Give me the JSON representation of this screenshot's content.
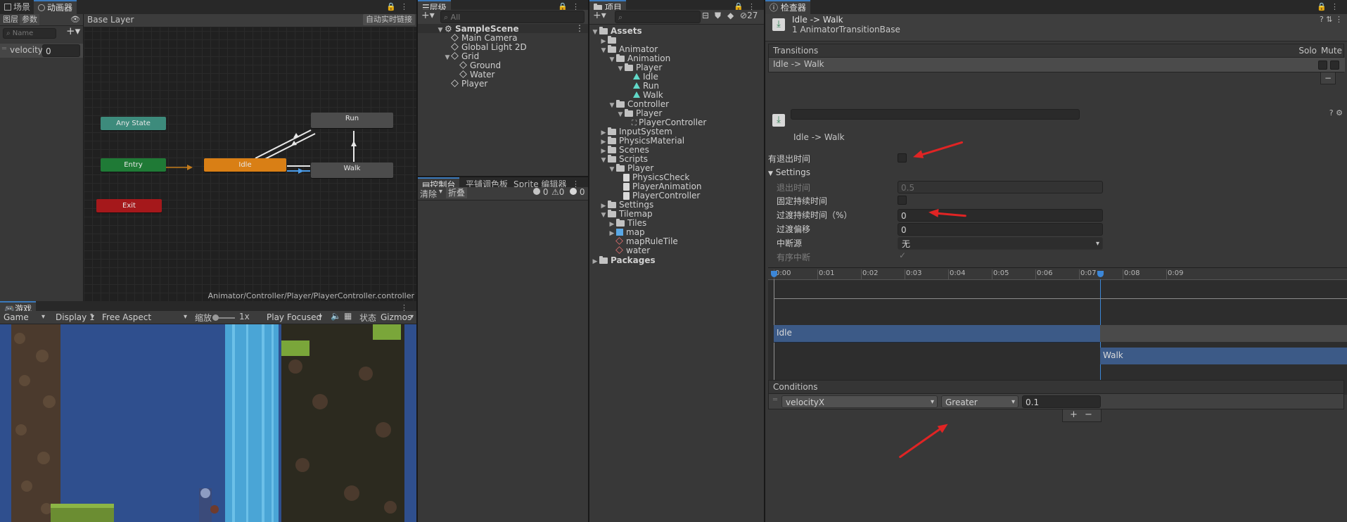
{
  "scene_tabs": {
    "scene": "场景",
    "animator": "动画器"
  },
  "animator": {
    "subtabs": [
      "图层",
      "参数"
    ],
    "breadcrumb": "Base Layer",
    "auto_live_link": "自动实时链接",
    "name_placeholder": "Name",
    "param": {
      "name": "velocityX",
      "value": "0"
    },
    "states": {
      "any": "Any State",
      "entry": "Entry",
      "exit": "Exit",
      "idle": "Idle",
      "run": "Run",
      "walk": "Walk"
    },
    "footer_path": "Animator/Controller/Player/PlayerController.controller"
  },
  "game": {
    "tab": "游戏",
    "mode": "Game",
    "display": "Display 1",
    "aspect": "Free Aspect",
    "scale_label": "缩放",
    "scale_value": "1x",
    "play_focused": "Play Focused",
    "stats": "状态",
    "gizmos": "Gizmos"
  },
  "hierarchy": {
    "tab": "层级",
    "search_placeholder": "All",
    "scene": "SampleScene",
    "items": [
      "Main Camera",
      "Global Light 2D",
      "Grid",
      "Ground",
      "Water",
      "Player"
    ]
  },
  "console": {
    "tabs": [
      "控制台",
      "平铺调色板",
      "Sprite 编辑器"
    ],
    "clear": "清除",
    "collapse": "折叠",
    "counts": {
      "log": "0",
      "warn": "0",
      "error": "0"
    }
  },
  "project": {
    "tab": "项目",
    "hidden_count": "27",
    "tree": {
      "assets": "Assets",
      "animator": "Animator",
      "animation": "Animation",
      "player1": "Player",
      "idle": "Idle",
      "run": "Run",
      "walk": "Walk",
      "controller": "Controller",
      "player2": "Player",
      "playercontroller": "PlayerController",
      "inputsystem": "InputSystem",
      "physicsmaterial": "PhysicsMaterial",
      "scenes": "Scenes",
      "scripts": "Scripts",
      "player3": "Player",
      "physicscheck": "PhysicsCheck",
      "playeranimation": "PlayerAnimation",
      "playercontroller2": "PlayerController",
      "settings": "Settings",
      "tilemap": "Tilemap",
      "tiles": "Tiles",
      "map": "map",
      "mapruletile": "mapRuleTile",
      "water": "water",
      "packages": "Packages"
    }
  },
  "inspector": {
    "tab": "检查器",
    "header_title": "Idle -> Walk",
    "header_subtitle": "1 AnimatorTransitionBase",
    "transitions_label": "Transitions",
    "solo": "Solo",
    "mute": "Mute",
    "transition_row": "Idle -> Walk",
    "minus": "−",
    "plus": "+",
    "sub_title": "Idle -> Walk",
    "has_exit_time": "有退出时间",
    "has_exit_time_checked": false,
    "settings": "Settings",
    "exit_time": "退出时间",
    "exit_time_value": "0.5",
    "fixed_duration": "固定持续时间",
    "transition_duration": "过渡持续时间（%）",
    "transition_duration_value": "0",
    "transition_offset": "过渡偏移",
    "transition_offset_value": "0",
    "interruption_source": "中断源",
    "interruption_source_value": "无",
    "ordered_interruption": "有序中断",
    "ordered_check": "✓",
    "timeline": {
      "ticks": [
        "0:00",
        "0:01",
        "0:02",
        "0:03",
        "0:04",
        "0:05",
        "0:06",
        "0:07",
        "0:08",
        "0:09"
      ],
      "idle": "Idle",
      "walk": "Walk"
    },
    "conditions": {
      "label": "Conditions",
      "param": "velocityX",
      "mode": "Greater",
      "value": "0.1"
    }
  },
  "colors": {
    "accent": "#3a79bb",
    "idle_state": "#d97f15",
    "entry_state": "#1f7a36",
    "any_state": "#3d8b7c",
    "exit_state": "#a5181b",
    "default_state": "#4c4c4c",
    "annotation_red": "#e02424"
  }
}
